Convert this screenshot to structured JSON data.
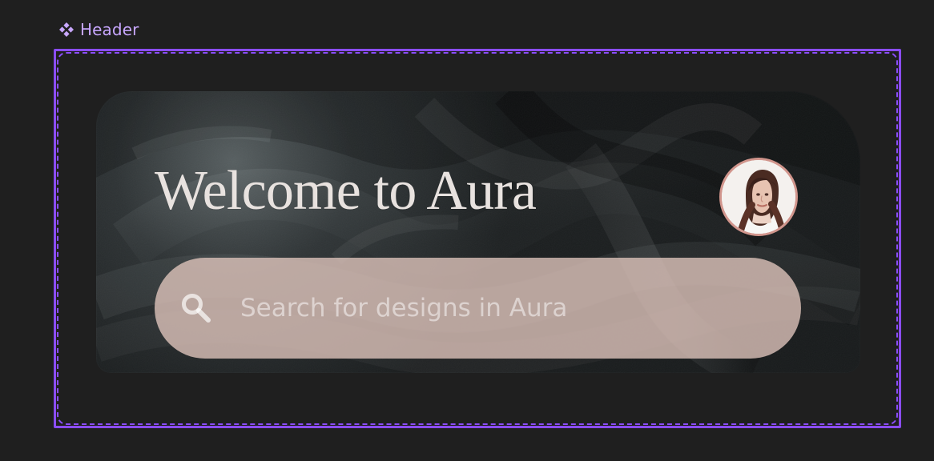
{
  "component": {
    "label": "Header",
    "icon": "component-diamond-icon",
    "accent_color": "#8b4dff",
    "label_color": "#c8a7ff"
  },
  "header": {
    "title": "Welcome to Aura",
    "avatar_icon": "profile-avatar",
    "search": {
      "placeholder": "Search for designs in Aura",
      "value": "",
      "icon": "search-icon"
    }
  }
}
